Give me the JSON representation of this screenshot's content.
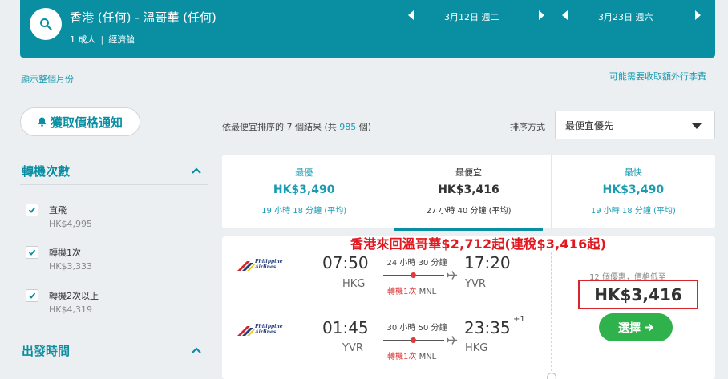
{
  "search": {
    "route": "香港 (任何) - 溫哥華 (任何)",
    "passengers": "1 成人",
    "cabin": "經濟艙",
    "depart_date": "3月12日 週二",
    "return_date": "3月23日 週六"
  },
  "links": {
    "show_month": "顯示整個月份",
    "extra_fees": "可能需要收取額外行李費"
  },
  "sidebar": {
    "price_alert": "獲取價格通知",
    "stops_title": "轉機次數",
    "stops": [
      {
        "label": "直飛",
        "price": "HK$4,995",
        "checked": true
      },
      {
        "label": "轉機1次",
        "price": "HK$3,333",
        "checked": true
      },
      {
        "label": "轉機2次以上",
        "price": "HK$4,319",
        "checked": true
      }
    ],
    "depart_time_title": "出發時間"
  },
  "results": {
    "prefix": "依",
    "sort_key": "最便宜",
    "mid": "排序的 7 個結果 (共 ",
    "total": "985",
    "suffix": " 個)",
    "sort_label": "排序方式",
    "sort_value": "最便宜優先"
  },
  "tabs": [
    {
      "label": "最優",
      "price": "HK$3,490",
      "duration": "19 小時 18 分鐘 (平均)",
      "active": false
    },
    {
      "label": "最便宜",
      "price": "HK$3,416",
      "duration": "27 小時 40 分鐘 (平均)",
      "active": true
    },
    {
      "label": "最快",
      "price": "HK$3,490",
      "duration": "19 小時 18 分鐘 (平均)",
      "active": false
    }
  ],
  "banner": "香港來回溫哥華$2,712起(連稅$3,416起)",
  "flight": {
    "airline": "Philippine Airlines",
    "airline_line1": "Philippine",
    "airline_line2": "Airlines",
    "outbound": {
      "depart_time": "07:50",
      "depart_code": "HKG",
      "arrive_time": "17:20",
      "arrive_code": "YVR",
      "duration": "24 小時 30 分鐘",
      "stops": "轉機1次",
      "via": "MNL"
    },
    "inbound": {
      "depart_time": "01:45",
      "depart_code": "YVR",
      "arrive_time": "23:35",
      "plus_day": "+1",
      "arrive_code": "HKG",
      "duration": "30 小時 50 分鐘",
      "stops": "轉機1次",
      "via": "MNL"
    },
    "deals": "12 個優惠，價格低至",
    "price": "HK$3,416",
    "select_label": "選擇"
  },
  "colors": {
    "teal": "#0a8fa2",
    "link": "#1a9bb0",
    "green": "#2fb14b",
    "red": "#d6262c"
  }
}
